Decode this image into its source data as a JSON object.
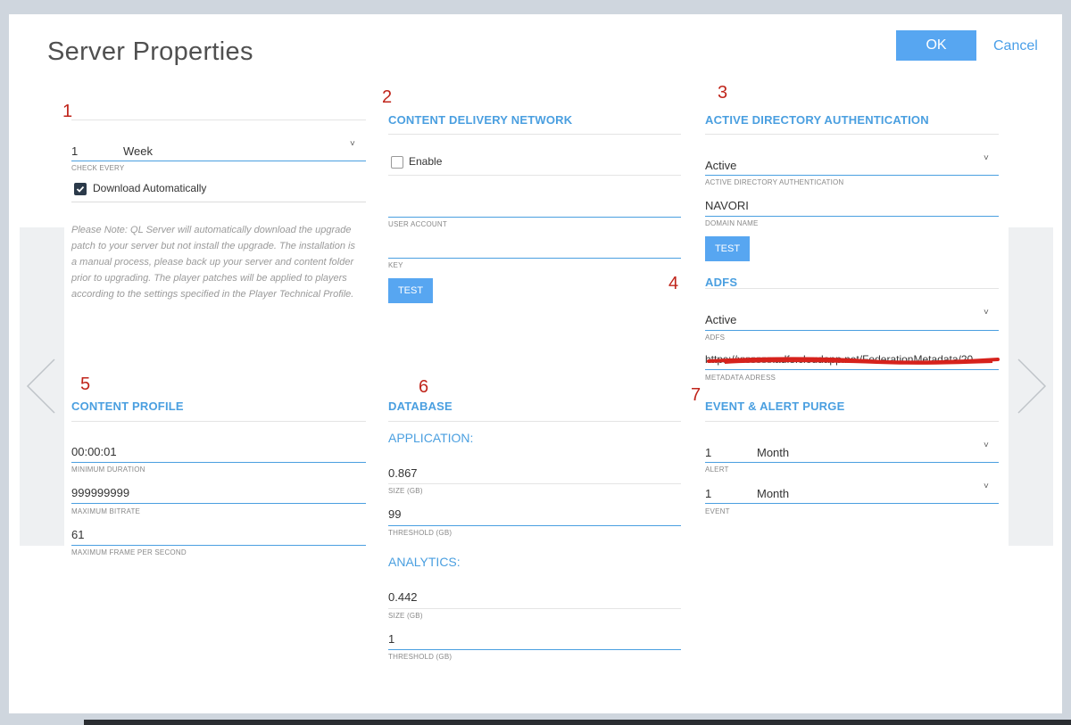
{
  "dialog": {
    "title": "Server Properties",
    "ok_label": "OK",
    "cancel_label": "Cancel"
  },
  "markers": [
    "1",
    "2",
    "3",
    "4",
    "5",
    "6",
    "7"
  ],
  "upgrade": {
    "check_every_value": "1",
    "check_every_unit": "Week",
    "check_every_caption": "CHECK EVERY",
    "download_label": "Download Automatically",
    "download_checked": true,
    "note": "Please Note: QL Server will automatically download the upgrade patch to your server but not install the upgrade. The installation is a manual process, please back up your server and content folder prior to upgrading. The player patches will be applied to players according to the settings specified in the Player Technical Profile."
  },
  "cdn": {
    "title": "CONTENT DELIVERY NETWORK",
    "enable_label": "Enable",
    "enable_checked": false,
    "user_account_caption": "USER ACCOUNT",
    "key_caption": "KEY",
    "test_label": "TEST"
  },
  "ad": {
    "title": "ACTIVE DIRECTORY AUTHENTICATION",
    "value": "Active",
    "caption": "ACTIVE DIRECTORY AUTHENTICATION",
    "domain_value": "NAVORI",
    "domain_caption": "DOMAIN NAME",
    "test_label": "TEST"
  },
  "adfs": {
    "title": "ADFS",
    "value": "Active",
    "caption": "ADFS",
    "metadata_value": "https://xxxxxxxadfs.cloudapp.net/FederationMetadata/20",
    "metadata_caption": "METADATA ADRESS"
  },
  "content_profile": {
    "title": "CONTENT PROFILE",
    "min_duration": "00:00:01",
    "min_duration_caption": "MINIMUM DURATION",
    "max_bitrate": "999999999",
    "max_bitrate_caption": "MAXIMUM BITRATE",
    "max_fps": "61",
    "max_fps_caption": "MAXIMUM FRAME PER SECOND"
  },
  "database": {
    "title": "DATABASE",
    "application_label": "APPLICATION:",
    "app_size": "0.867",
    "app_size_caption": "SIZE (GB)",
    "app_threshold": "99",
    "app_threshold_caption": "THRESHOLD (GB)",
    "analytics_label": "ANALYTICS:",
    "an_size": "0.442",
    "an_size_caption": "SIZE (GB)",
    "an_threshold": "1",
    "an_threshold_caption": "THRESHOLD (GB)"
  },
  "purge": {
    "title": "EVENT & ALERT PURGE",
    "alert_value": "1",
    "alert_unit": "Month",
    "alert_caption": "ALERT",
    "event_value": "1",
    "event_unit": "Month",
    "event_caption": "EVENT"
  },
  "colors": {
    "accent": "#4a9fe0",
    "button": "#57a6f1",
    "marker": "#c0251b"
  },
  "icons": [
    "chevron-left-icon",
    "chevron-right-icon",
    "chevron-down-icon",
    "check-icon"
  ]
}
